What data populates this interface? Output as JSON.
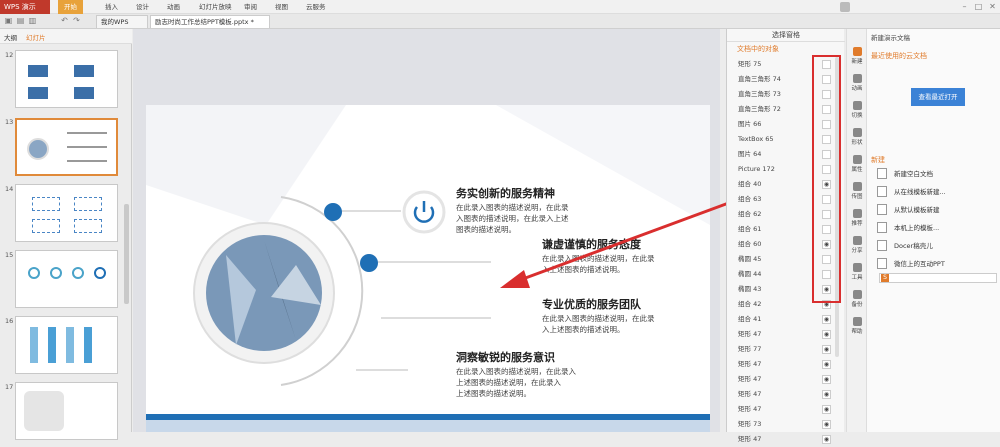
{
  "app": {
    "title": "WPS 演示",
    "menus": [
      "开始",
      "插入",
      "设计",
      "动画",
      "幻灯片放映",
      "审阅",
      "视图",
      "云服务"
    ],
    "active_menu": "开始"
  },
  "tabs": [
    {
      "label": "我的WPS"
    },
    {
      "label": "励志时尚工作总结PPT模板.pptx *"
    }
  ],
  "left": {
    "tab_outline": "大纲",
    "tab_slides": "幻灯片",
    "slide_numbers": [
      "12",
      "13",
      "14",
      "15",
      "16",
      "17"
    ],
    "selected_slide": "13"
  },
  "slide": {
    "items": [
      {
        "heading": "务实创新的服务精神",
        "desc": "在此录入图表的描述说明，在此录\n入图表的描述说明，在此录入上述\n图表的描述说明。"
      },
      {
        "heading": "谦虚谨慎的服务态度",
        "desc": "在此录入图表的描述说明，在此录\n入上述图表的描述说明。"
      },
      {
        "heading": "专业优质的服务团队",
        "desc": "在此录入图表的描述说明，在此录\n入上述图表的描述说明。"
      },
      {
        "heading": "洞察敏锐的服务意识",
        "desc": "在此录入图表的描述说明，在此录入\n上述图表的描述说明，在此录入\n上述图表的描述说明。"
      }
    ]
  },
  "selection_pane": {
    "title": "选择窗格",
    "objects_header": "文档中的对象",
    "objects": [
      "矩形 75",
      "直角三角形 74",
      "直角三角形 73",
      "直角三角形 72",
      "图片 66",
      "TextBox 65",
      "图片 64",
      "Picture 172",
      "组合 40",
      "组合 63",
      "组合 62",
      "组合 61",
      "组合 60",
      "椭圆 45",
      "椭圆 44",
      "椭圆 43",
      "组合 42",
      "组合 41",
      "矩形 47",
      "矩形 77",
      "矩形 47",
      "矩形 47",
      "矩形 47",
      "矩形 47",
      "矩形 73",
      "矩形 47"
    ],
    "visible_flags": [
      false,
      false,
      false,
      false,
      false,
      false,
      false,
      false,
      true,
      false,
      false,
      false,
      true,
      false,
      false,
      true,
      true,
      true,
      true,
      true,
      true,
      true,
      true,
      true,
      true,
      true
    ]
  },
  "sidebar_icons": [
    "新建",
    "动画",
    "切换",
    "形状",
    "属性",
    "传图",
    "推荐",
    "分享",
    "工具",
    "备份",
    "帮助"
  ],
  "new_panel": {
    "title": "新建演示文稿",
    "recent_link": "最近使用的云文档",
    "open_button": "查看最近打开",
    "section": "新建",
    "items": [
      "新建空白文档",
      "从在线模板新建...",
      "从默认模板新建",
      "本机上的模板...",
      "Docer稿壳儿",
      "微信上的互动PPT"
    ]
  },
  "colors": {
    "accent": "#e07b2b",
    "blue": "#1f6fb5",
    "red": "#d92e2e"
  }
}
